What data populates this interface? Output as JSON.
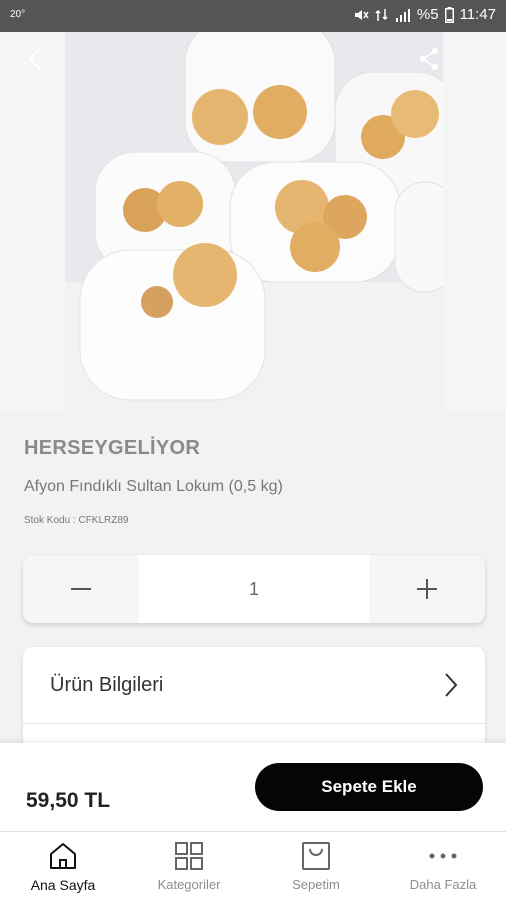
{
  "status_bar": {
    "left_text": "20°",
    "battery_text": "%5",
    "time": "11:47"
  },
  "product": {
    "brand": "HERSEYGELİYOR",
    "name": "Afyon Fındıklı Sultan Lokum (0,5 kg)",
    "stock_code_text": "Stok Kodu : CFKLRZ89",
    "image_icon": "product-photo-turkish-delight"
  },
  "quantity": {
    "value": "1",
    "minus_icon": "minus-icon",
    "plus_icon": "plus-icon"
  },
  "info": {
    "label": "Ürün Bilgileri",
    "chevron_icon": "chevron-right-icon"
  },
  "cart": {
    "price": "59,50 TL",
    "add_button_label": "Sepete Ekle",
    "button_color": "#050505"
  },
  "nav": {
    "items": [
      {
        "label": "Ana Sayfa",
        "icon": "home-icon",
        "active": true
      },
      {
        "label": "Kategoriler",
        "icon": "grid-icon",
        "active": false
      },
      {
        "label": "Sepetim",
        "icon": "bag-icon",
        "active": false
      },
      {
        "label": "Daha Fazla",
        "icon": "more-dots-icon",
        "active": false
      }
    ]
  }
}
